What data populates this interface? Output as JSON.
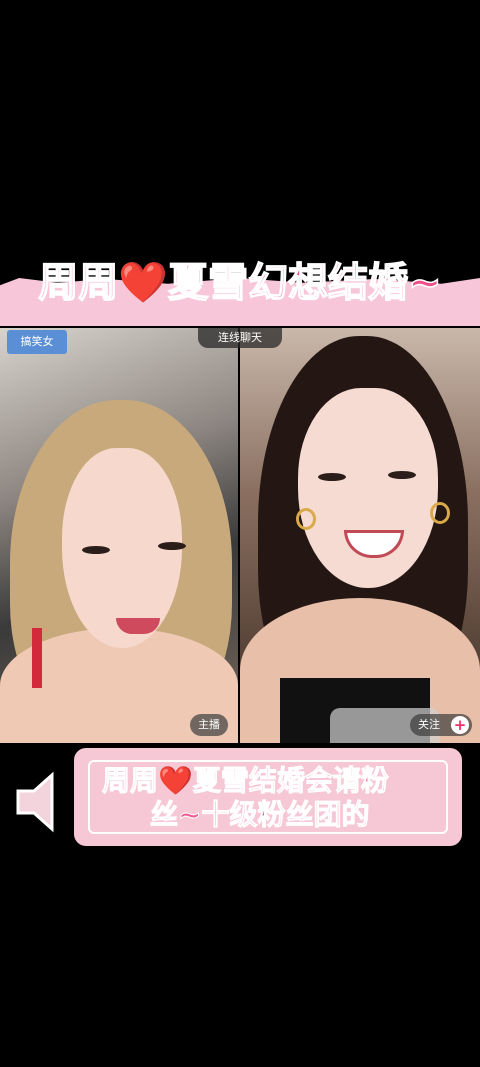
{
  "title": {
    "part1": "周周",
    "heart": "❤️",
    "part2": "夏雪幻想结婚~"
  },
  "video": {
    "left_tag": "搞笑女",
    "center_tag": "连线聊天",
    "host_label": "主播",
    "follow_label": "关注",
    "follow_icon": "+"
  },
  "subtitle": {
    "line1_part1": "周周",
    "heart": "❤️",
    "line1_part2": "夏雪结婚会请粉",
    "line2": "丝~十级粉丝团的"
  },
  "colors": {
    "title_pink": "#f0508a",
    "banner_pink": "#f7c6d8",
    "subtitle_pink": "#f05b93",
    "box_pink": "#f6c7d4",
    "tag_blue": "#5a8fd6"
  },
  "icons": {
    "speaker": "speaker-icon",
    "heart": "heart-icon",
    "plus": "plus-icon"
  }
}
